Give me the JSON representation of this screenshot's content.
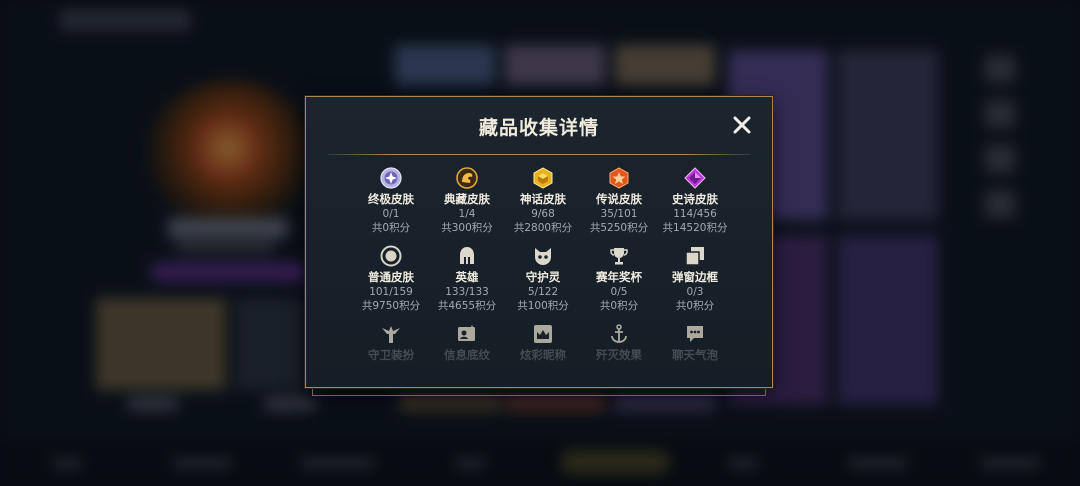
{
  "modal": {
    "title": "藏品收集详情",
    "close_icon": "close-icon",
    "accent_color": "#a8884e"
  },
  "collections": [
    {
      "label": "终极皮肤",
      "count": "0/1",
      "points": "共0积分",
      "icon": "ultimate-skin-icon"
    },
    {
      "label": "典藏皮肤",
      "count": "1/4",
      "points": "共300积分",
      "icon": "exalted-skin-icon"
    },
    {
      "label": "神话皮肤",
      "count": "9/68",
      "points": "共2800积分",
      "icon": "mythic-skin-icon"
    },
    {
      "label": "传说皮肤",
      "count": "35/101",
      "points": "共5250积分",
      "icon": "legendary-skin-icon"
    },
    {
      "label": "史诗皮肤",
      "count": "114/456",
      "points": "共14520积分",
      "icon": "epic-skin-icon"
    },
    {
      "label": "普通皮肤",
      "count": "101/159",
      "points": "共9750积分",
      "icon": "standard-skin-icon"
    },
    {
      "label": "英雄",
      "count": "133/133",
      "points": "共4655积分",
      "icon": "champion-helmet-icon"
    },
    {
      "label": "守护灵",
      "count": "5/122",
      "points": "共100积分",
      "icon": "little-legend-icon"
    },
    {
      "label": "赛年奖杯",
      "count": "0/5",
      "points": "共0积分",
      "icon": "trophy-icon"
    },
    {
      "label": "弹窗边框",
      "count": "0/3",
      "points": "共0积分",
      "icon": "popup-border-icon"
    },
    {
      "label": "守卫装扮",
      "icon": "ward-skin-icon"
    },
    {
      "label": "信息底纹",
      "icon": "banner-icon"
    },
    {
      "label": "炫彩昵称",
      "icon": "title-crown-icon"
    },
    {
      "label": "歼灭效果",
      "icon": "anchor-icon"
    },
    {
      "label": "聊天气泡",
      "icon": "chat-bubble-icon"
    }
  ]
}
